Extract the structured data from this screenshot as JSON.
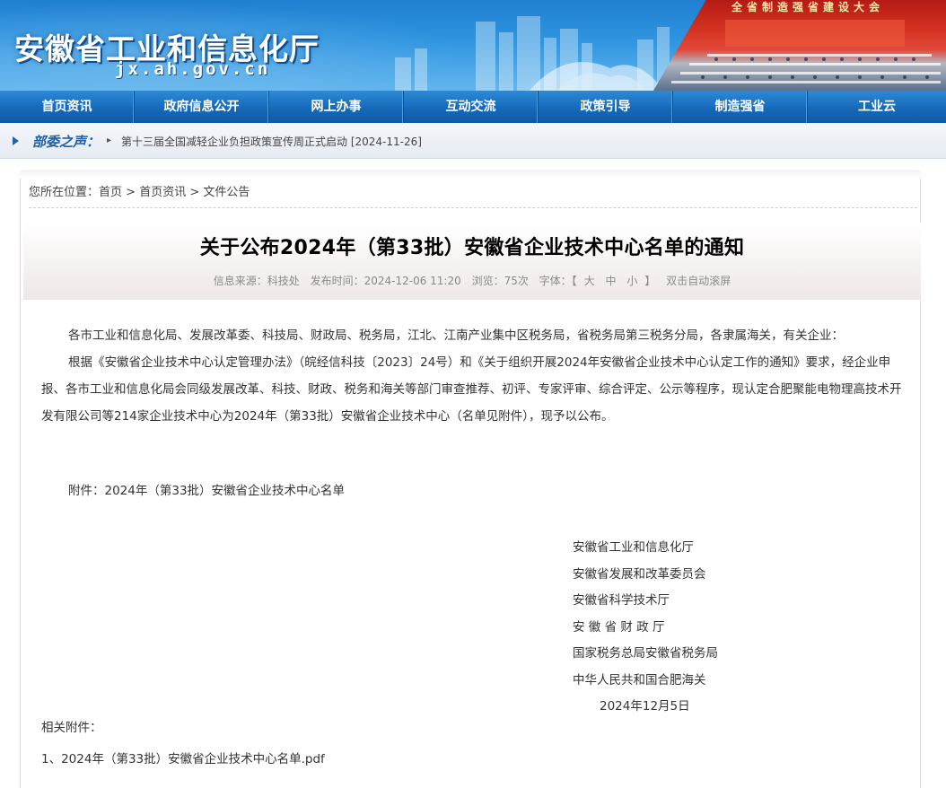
{
  "header": {
    "site_title": "安徽省工业和信息化厅",
    "site_domain": "jx.ah.gov.cn",
    "banner_caption": "全省制造强省建设大会"
  },
  "nav": {
    "items": [
      "首页资讯",
      "政府信息公开",
      "网上办事",
      "互动交流",
      "政策引导",
      "制造强省",
      "工业云"
    ]
  },
  "ticker": {
    "label": "部委之声：",
    "news": "第十三届全国减轻企业负担政策宣传周正式启动 [2024-11-26]"
  },
  "breadcrumb": {
    "prefix": "您所在位置：",
    "items": [
      "首页",
      "首页资讯",
      "文件公告"
    ],
    "separator": ">"
  },
  "article": {
    "title": "关于公布2024年（第33批）安徽省企业技术中心名单的通知",
    "meta": {
      "source": "信息来源：科技处",
      "published": "发布时间：2024-12-06 11:20",
      "views": "浏览：75次",
      "font_label": "字体：【",
      "font_large": "大",
      "font_medium": "中",
      "font_small": "小",
      "font_close": "】",
      "autoscroll": "双击自动滚屏"
    },
    "paragraphs": [
      "各市工业和信息化局、发展改革委、科技局、财政局、税务局，江北、江南产业集中区税务局，省税务局第三税务分局，各隶属海关，有关企业：",
      "根据《安徽省企业技术中心认定管理办法》（皖经信科技〔2023〕24号）和《关于组织开展2024年安徽省企业技术中心认定工作的通知》要求，经企业申报、各市工业和信息化局会同级发展改革、科技、财政、税务和海关等部门审查推荐、初评、专家评审、综合评定、公示等程序，现认定合肥聚能电物理高技术开发有限公司等214家企业技术中心为2024年（第33批）安徽省企业技术中心（名单见附件），现予以公布。"
    ],
    "attachment_line": "附件：2024年（第33批）安徽省企业技术中心名单",
    "signers": [
      "安徽省工业和信息化厅",
      "安徽省发展和改革委员会",
      "安徽省科学技术厅",
      "安 徽 省 财 政 厅",
      "国家税务总局安徽省税务局",
      "中华人民共和国合肥海关"
    ],
    "date": "2024年12月5日",
    "related_label": "相关附件：",
    "related_file": "1、2024年（第33批）安徽省企业技术中心名单.pdf"
  }
}
